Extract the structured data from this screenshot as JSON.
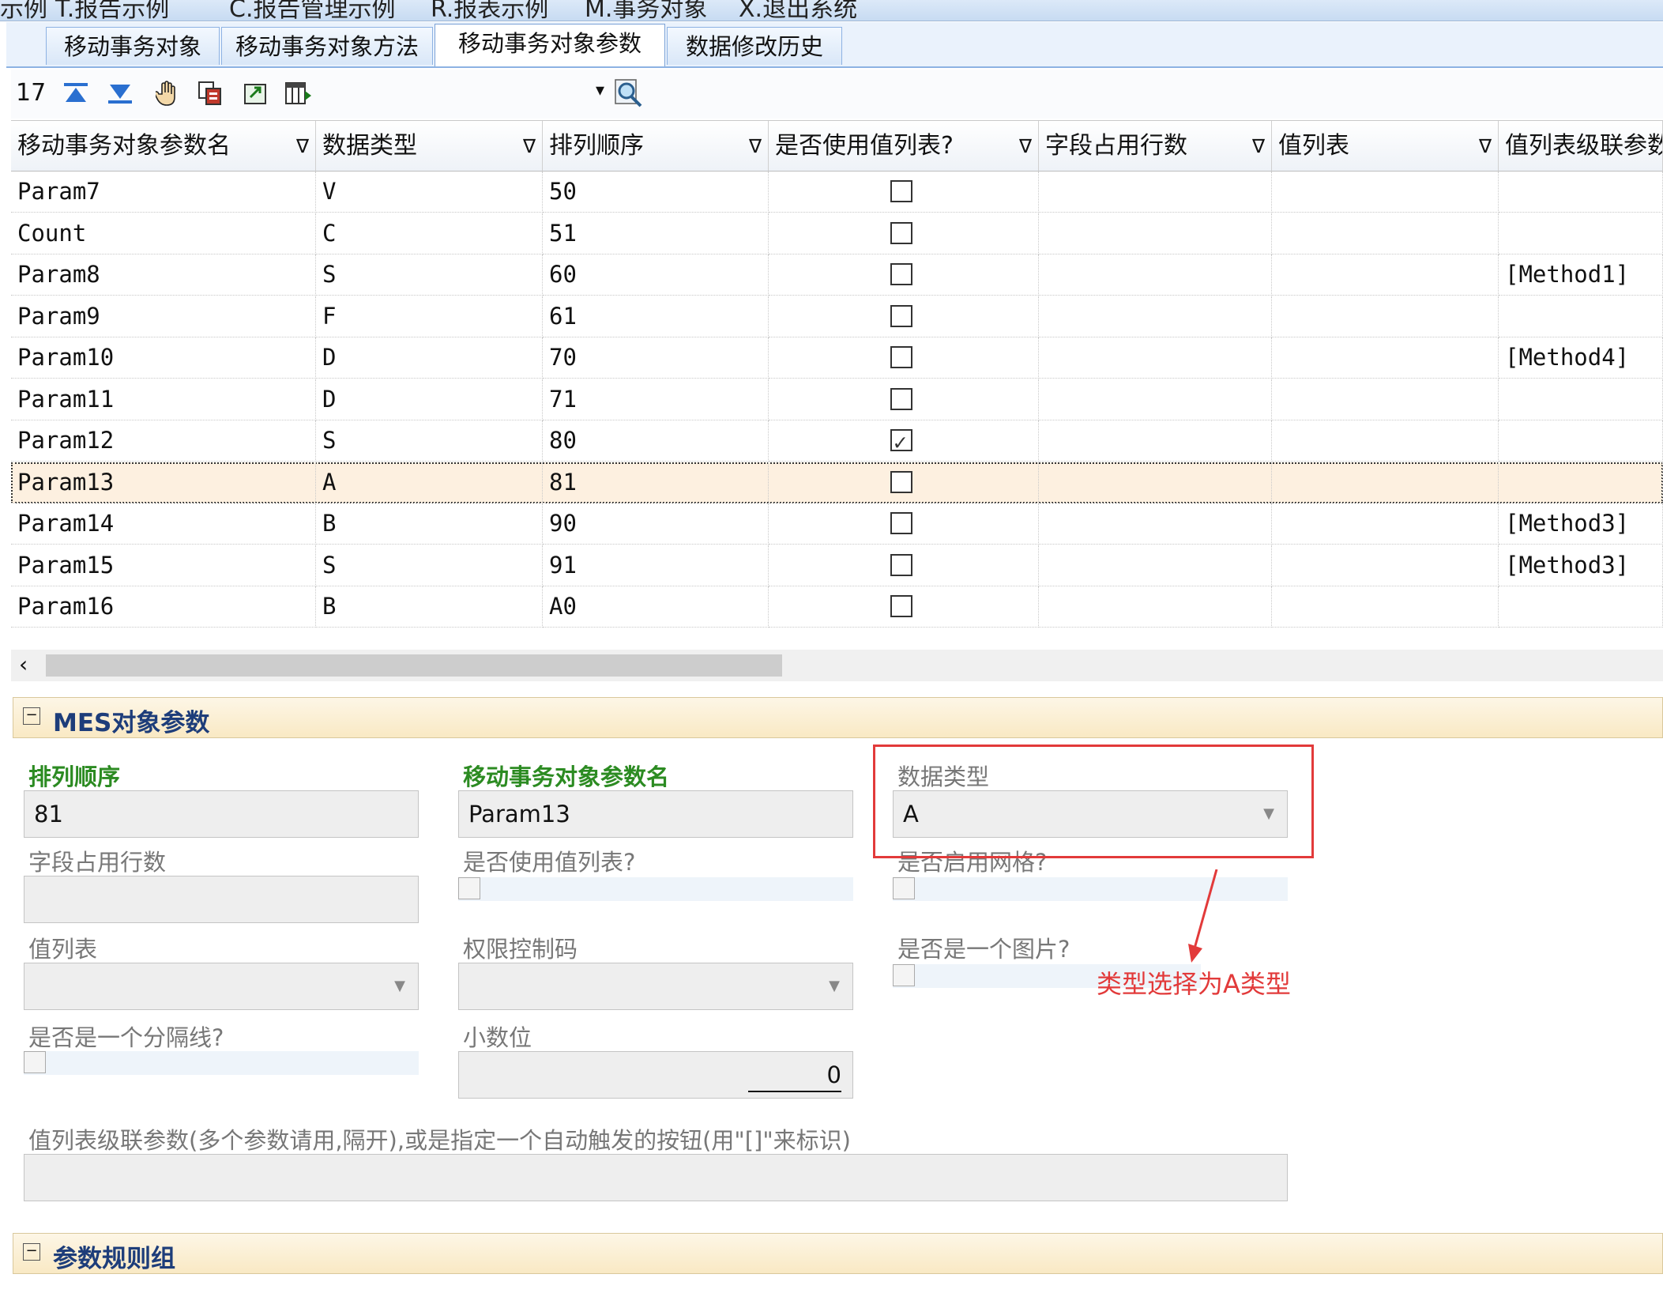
{
  "menubar": {
    "items": [
      "示例",
      "T.报告示例",
      "C.报告管理示例",
      "R.报表示例",
      "M.事务对象",
      "X.退出系统"
    ]
  },
  "tabs": [
    {
      "label": "移动事务对象"
    },
    {
      "label": "移动事务对象方法"
    },
    {
      "label": "移动事务对象参数"
    },
    {
      "label": "数据修改历史"
    }
  ],
  "active_tab": 2,
  "toolbar": {
    "record_count": "17",
    "icons": [
      "move-top-icon",
      "move-bottom-icon",
      "hand-icon",
      "copy-icon",
      "export-icon",
      "columns-icon",
      "dropdown-arrow-icon",
      "search-icon"
    ]
  },
  "grid": {
    "columns": [
      "移动事务对象参数名",
      "数据类型",
      "排列顺序",
      "是否使用值列表?",
      "字段占用行数",
      "值列表",
      "值列表级联参数"
    ],
    "rows": [
      [
        "Param7",
        "V",
        "50",
        false,
        "",
        "",
        ""
      ],
      [
        "Count",
        "C",
        "51",
        false,
        "",
        "",
        ""
      ],
      [
        "Param8",
        "S",
        "60",
        false,
        "",
        "",
        "[Method1]"
      ],
      [
        "Param9",
        "F",
        "61",
        false,
        "",
        "",
        ""
      ],
      [
        "Param10",
        "D",
        "70",
        false,
        "",
        "",
        "[Method4]"
      ],
      [
        "Param11",
        "D",
        "71",
        false,
        "",
        "",
        ""
      ],
      [
        "Param12",
        "S",
        "80",
        true,
        "",
        "",
        ""
      ],
      [
        "Param13",
        "A",
        "81",
        false,
        "",
        "",
        ""
      ],
      [
        "Param14",
        "B",
        "90",
        false,
        "",
        "",
        "[Method3]"
      ],
      [
        "Param15",
        "S",
        "91",
        false,
        "",
        "",
        "[Method3]"
      ],
      [
        "Param16",
        "B",
        "A0",
        false,
        "",
        "",
        ""
      ]
    ],
    "selected_row": 7
  },
  "section_mes": {
    "title": "MES对象参数"
  },
  "form": {
    "order_label": "排列顺序",
    "order_value": "81",
    "name_label": "移动事务对象参数名",
    "name_value": "Param13",
    "type_label": "数据类型",
    "type_value": "A",
    "rows_label": "字段占用行数",
    "rows_value": "",
    "use_valuelist_label": "是否使用值列表?",
    "grid_enabled_label": "是否启用网格?",
    "valuelist_label": "值列表",
    "valuelist_value": "",
    "perm_label": "权限控制码",
    "perm_value": "",
    "is_image_label": "是否是一个图片?",
    "is_separator_label": "是否是一个分隔线?",
    "decimals_label": "小数位",
    "decimals_value": "0",
    "cascade_label": "值列表级联参数(多个参数请用,隔开),或是指定一个自动触发的按钮(用\"[]\"来标识)",
    "cascade_value": ""
  },
  "annotation": {
    "text": "类型选择为A类型",
    "color": "#e23a3a"
  },
  "section_rules": {
    "title": "参数规则组"
  }
}
